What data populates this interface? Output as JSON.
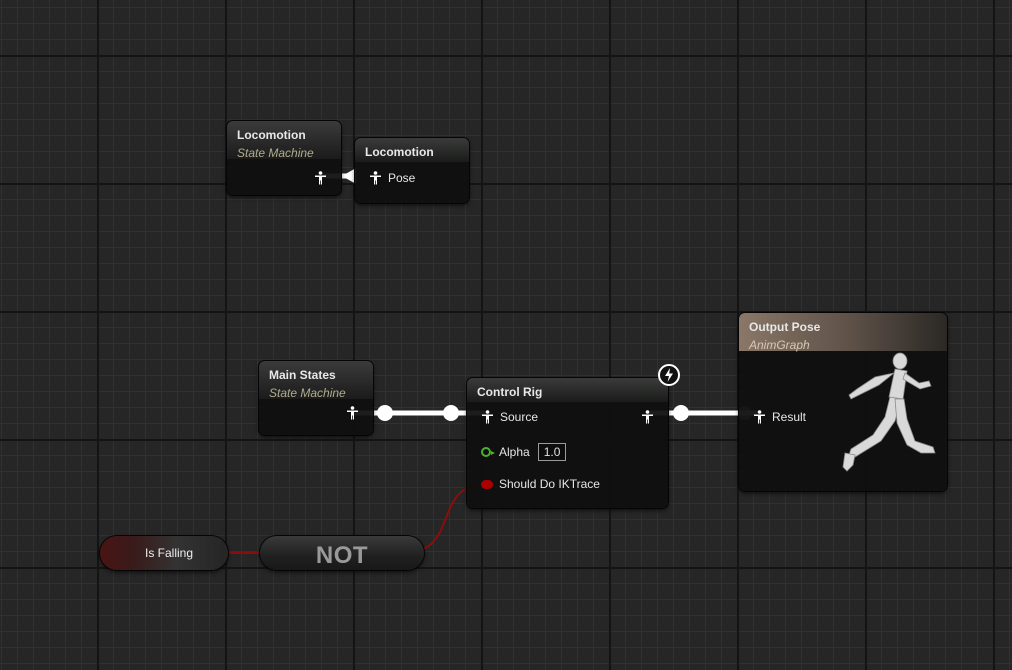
{
  "nodes": {
    "locomotion_state_machine": {
      "title": "Locomotion",
      "subtitle": "State Machine"
    },
    "locomotion_pose": {
      "title": "Locomotion",
      "pin_label": "Pose"
    },
    "main_states": {
      "title": "Main States",
      "subtitle": "State Machine"
    },
    "control_rig": {
      "title": "Control Rig",
      "source_label": "Source",
      "alpha_label": "Alpha",
      "alpha_value": "1.0",
      "should_do_ik_label": "Should Do IKTrace"
    },
    "output_pose": {
      "title": "Output Pose",
      "subtitle": "AnimGraph",
      "result_label": "Result"
    },
    "is_falling": {
      "label": "Is Falling"
    },
    "not_node": {
      "label": "NOT"
    }
  },
  "icons": {
    "pose_pin": "person-pose-icon",
    "exec_badge": "lightning-bolt-icon",
    "preview": "mannequin-running-icon"
  },
  "colors": {
    "pose_wire": "#ffffff",
    "bool_wire": "#8c0d0d",
    "bool_pin": "#aa0000",
    "float_pin": "#4cb12f",
    "subtitle": "#b1ac8c",
    "output_header": "#8a7767"
  }
}
